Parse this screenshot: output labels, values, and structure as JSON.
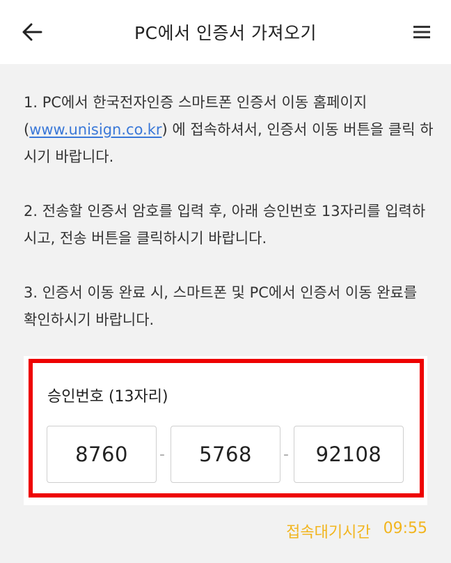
{
  "header": {
    "title": "PC에서 인증서 가져오기"
  },
  "instructions": {
    "step1_before_link": "1. PC에서 한국전자인증 스마트폰 인증서 이동 홈페이지 (",
    "step1_link": "www.unisign.co.kr",
    "step1_after_link": ") 에 접속하셔서, 인증서 이동 버튼을 클릭 하시기 바랍니다.",
    "step2": "2. 전송할 인증서 암호를 입력 후, 아래 승인번호 13자리를 입력하시고, 전송 버튼을 클릭하시기 바랍니다.",
    "step3": "3. 인증서 이동 완료 시, 스마트폰 및 PC에서 인증서 이동 완료를 확인하시기 바랍니다."
  },
  "approval": {
    "label": "승인번호 (13자리)",
    "code_part1": "8760",
    "code_part2": "5768",
    "code_part3": "92108",
    "separator": "-"
  },
  "timer": {
    "label": "접속대기시간",
    "value": "09:55"
  },
  "colors": {
    "highlight_border": "#ee0000",
    "link": "#3a78d8",
    "timer": "#f2b51e"
  },
  "icons": {
    "back": "arrow-left-icon",
    "menu": "hamburger-menu-icon"
  }
}
